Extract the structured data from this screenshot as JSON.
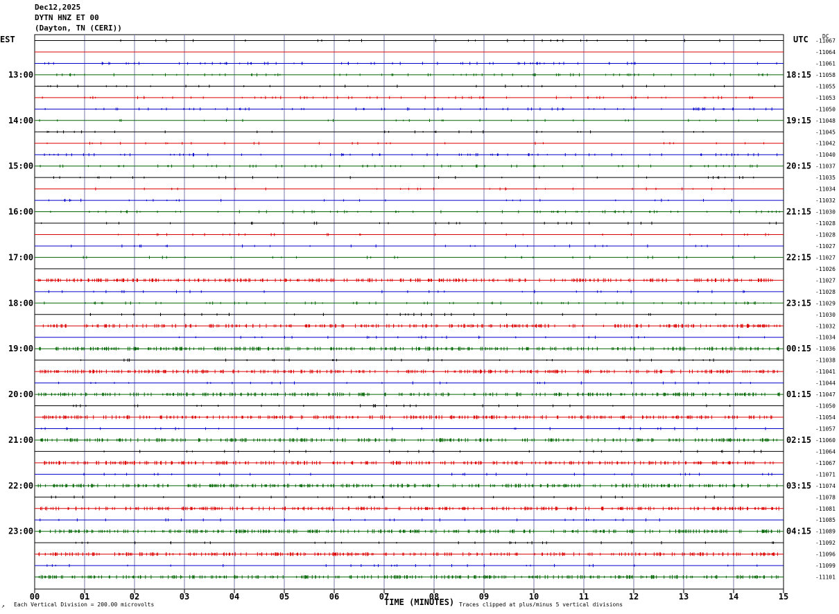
{
  "header": {
    "date": "Dec12,2025",
    "station": "DYTN HNZ ET 00",
    "location": "(Dayton, TN (CERI))"
  },
  "left_axis_label": "EST",
  "right_axis_label": "UTC",
  "dc_label": "DC",
  "footer": {
    "scale": "Each Vertical Division =  200.00 microvolts",
    "xlabel": "TIME (MINUTES)",
    "clip_note": "Traces clipped at plus/minus 5 vertical divisions",
    "corner_glyph": "↗"
  },
  "colors": {
    "trace_cycle": [
      "#000000",
      "#dd0000",
      "#0000cc",
      "#006600"
    ],
    "vertical_grid": "#7777aa"
  },
  "chart_data": {
    "type": "line",
    "title": "",
    "xlabel": "TIME (MINUTES)",
    "ylabel": "",
    "xlim": [
      0,
      15
    ],
    "x_ticks": [
      "00",
      "01",
      "02",
      "03",
      "04",
      "05",
      "06",
      "07",
      "08",
      "09",
      "10",
      "11",
      "12",
      "13",
      "14",
      "15"
    ],
    "grid": true,
    "traces_per_hour": 4,
    "first_trace_hour_offset": 0.25,
    "est_hour_labels": [
      "13:00",
      "14:00",
      "15:00",
      "16:00",
      "17:00",
      "18:00",
      "19:00",
      "20:00",
      "21:00",
      "22:00",
      "23:00"
    ],
    "utc_hour_labels": [
      "18:15",
      "19:15",
      "20:15",
      "21:15",
      "22:15",
      "23:15",
      "00:15",
      "01:15",
      "02:15",
      "03:15",
      "04:15"
    ],
    "dc_offsets": [
      -11067,
      -11064,
      -11061,
      -11058,
      -11055,
      -11053,
      -11050,
      -11048,
      -11045,
      -11042,
      -11040,
      -11037,
      -11035,
      -11034,
      -11032,
      -11030,
      -11028,
      -11028,
      -11027,
      -11027,
      -11026,
      -11027,
      -11028,
      -11029,
      -11030,
      -11032,
      -11034,
      -11036,
      -11038,
      -11041,
      -11044,
      -11047,
      -11050,
      -11054,
      -11057,
      -11060,
      -11064,
      -11067,
      -11071,
      -11074,
      -11078,
      -11081,
      -11085,
      -11089,
      -11092,
      -11096,
      -11099,
      -11101
    ],
    "trace_activity": [
      1,
      0,
      2,
      2,
      1,
      2,
      2,
      1,
      1,
      1,
      2,
      2,
      1,
      1,
      1,
      2,
      1,
      1,
      1,
      1,
      0,
      3,
      1,
      2,
      1,
      3,
      1,
      3,
      1,
      3,
      1,
      3,
      1,
      3,
      1,
      3,
      1,
      3,
      1,
      3,
      1,
      3,
      1,
      3,
      1,
      3,
      1,
      3
    ]
  }
}
